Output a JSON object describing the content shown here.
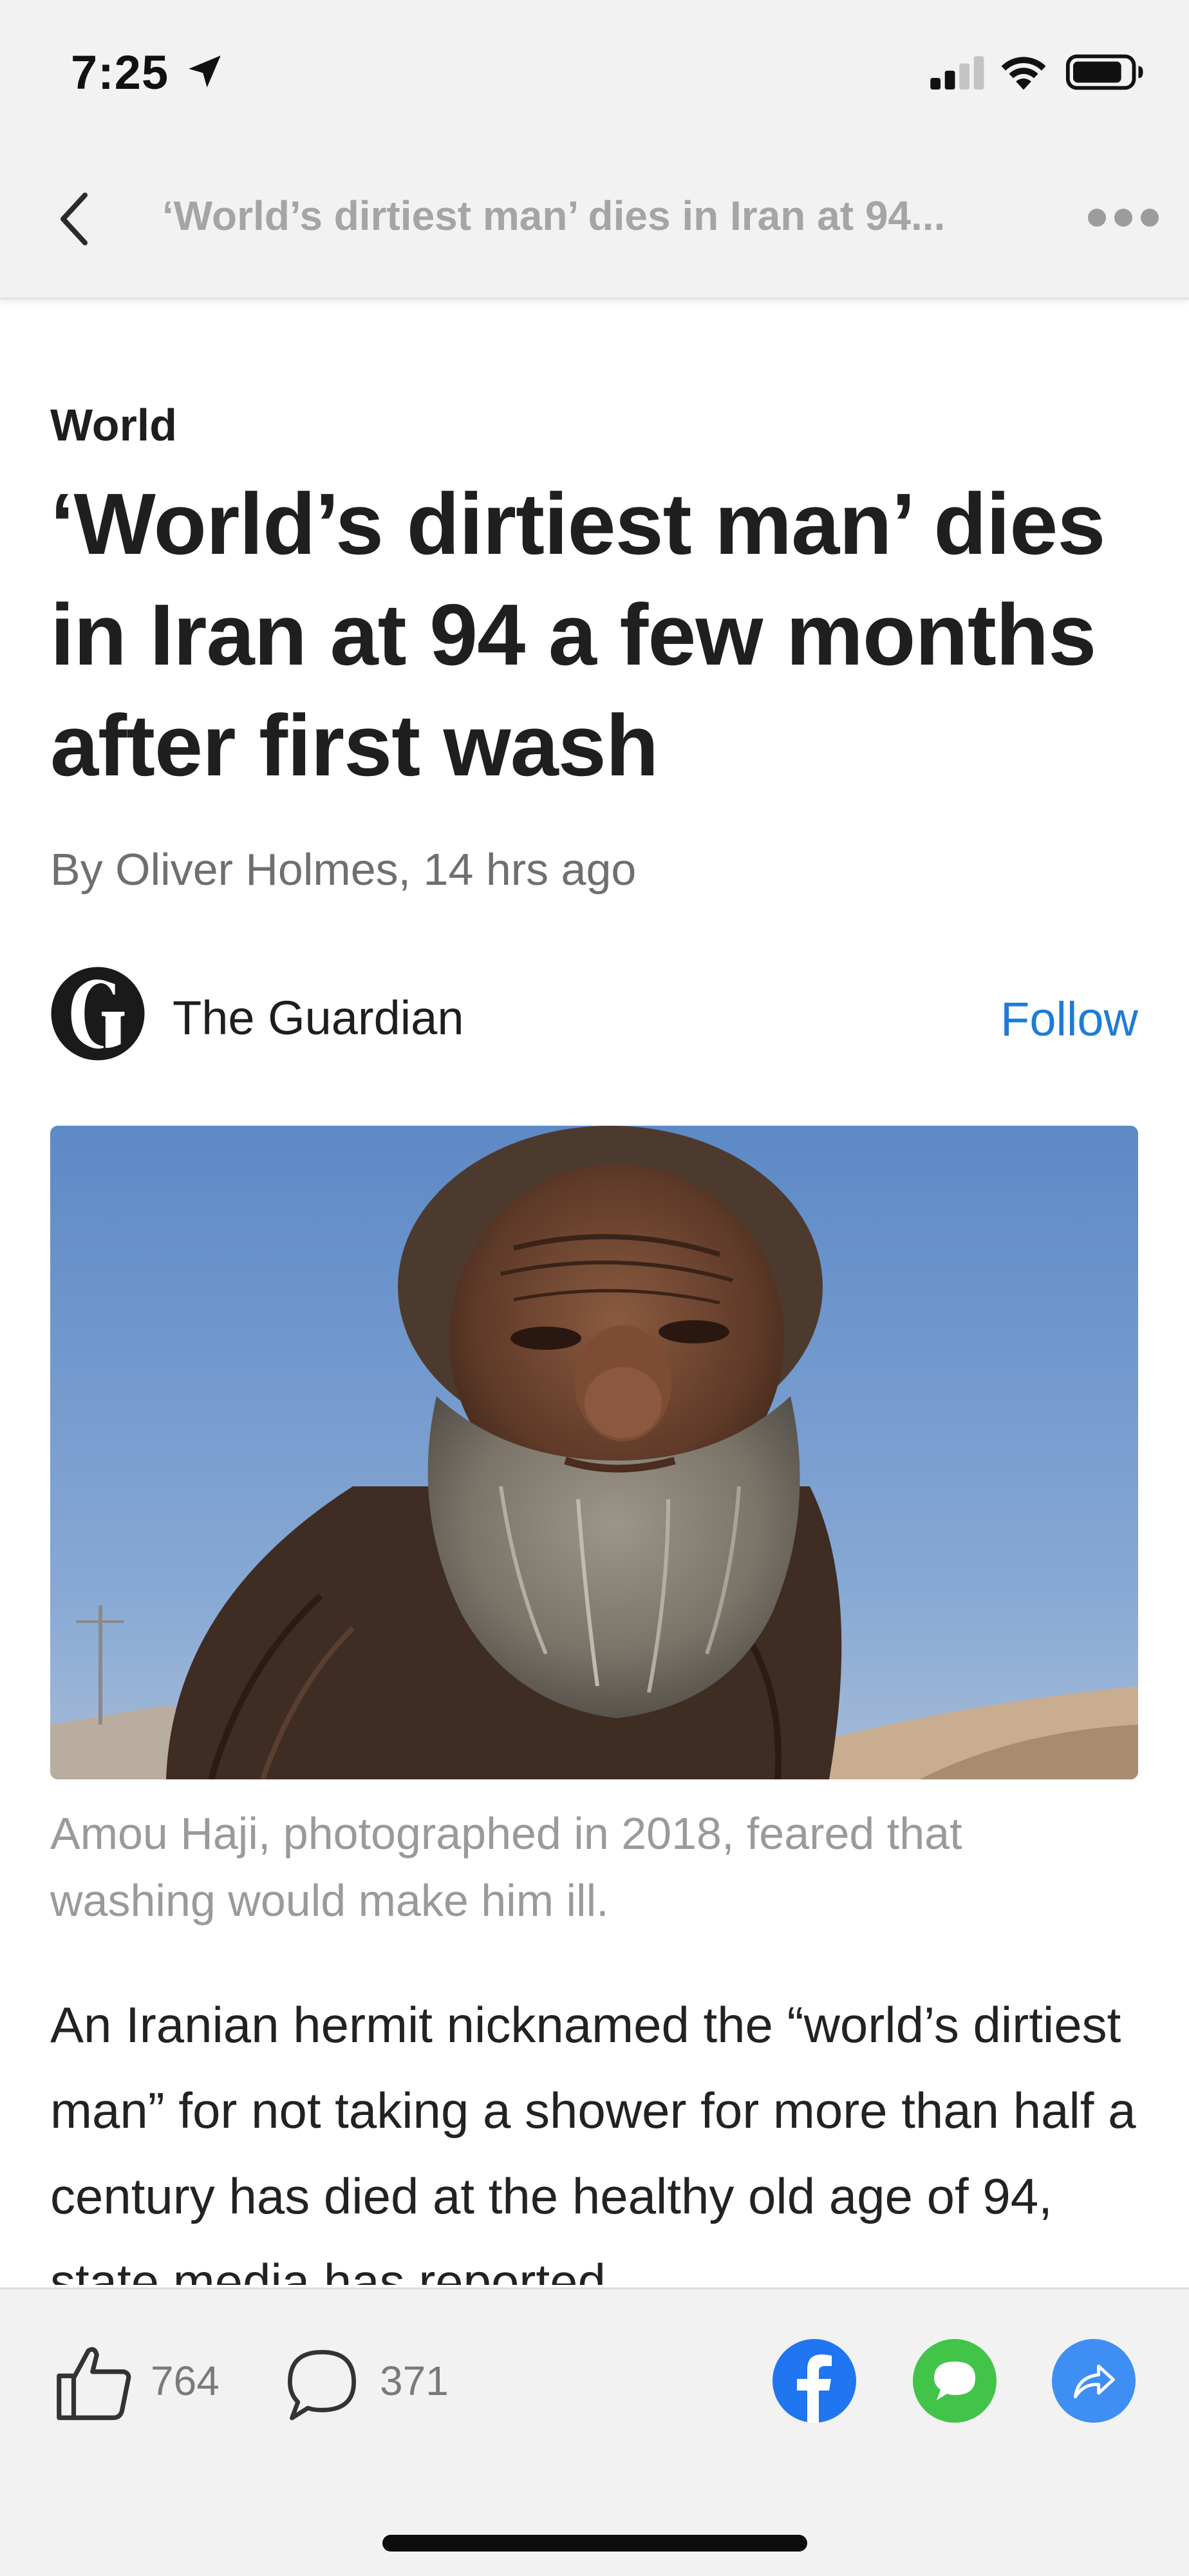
{
  "status_bar": {
    "time": "7:25"
  },
  "nav": {
    "title": "‘World’s dirtiest man’ dies in Iran at 94..."
  },
  "article": {
    "section": "World",
    "headline": "‘World’s dirtiest man’ dies in Iran at 94 a few months after first wash",
    "byline": "By Oliver Holmes, 14 hrs ago",
    "publisher": "The Guardian",
    "follow_label": "Follow",
    "image_alt": "Photo of Amou Haji, an elderly man with a long grey beard, against a blue sky",
    "caption": "Amou Haji, photographed in 2018, feared that washing would make him ill.",
    "body": "An Iranian hermit nicknamed the “world’s dirtiest man” for not taking a shower for more than half a century has died at the healthy old age of 94, state media has reported."
  },
  "actions": {
    "likes": "764",
    "comments": "371"
  },
  "colors": {
    "accent": "#1e7bd8",
    "facebook": "#1f76f0",
    "messages": "#42c448",
    "share": "#3f8ef3"
  }
}
